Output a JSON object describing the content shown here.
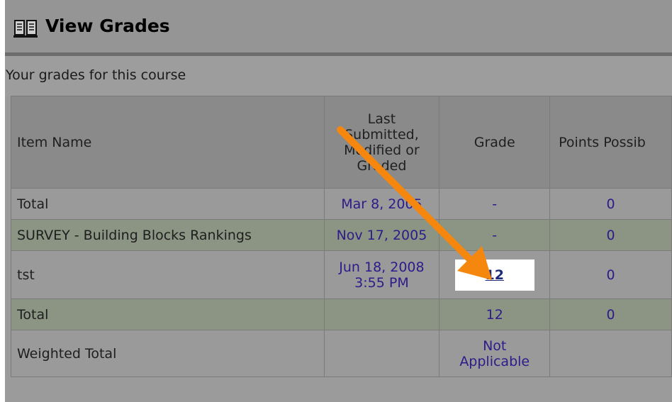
{
  "page": {
    "title": "View Grades",
    "caption": "Your grades for this course"
  },
  "icons": {
    "title_icon": "book-icon",
    "annotation": "arrow-icon",
    "arrow_color": "#f5870f"
  },
  "colors": {
    "link": "#2e1a8a",
    "row_alt": "#8c9584",
    "highlight": "#ffffff"
  },
  "table": {
    "columns": [
      "Item Name",
      "Last Submitted, Modified or Graded",
      "Grade",
      "Points Possib"
    ],
    "header_last_lines": [
      "Last",
      "Submitted,",
      "Modified or",
      "Graded"
    ],
    "rows": [
      {
        "name": "Total",
        "date": "Mar 8, 2005",
        "grade": "-",
        "points": "0"
      },
      {
        "name": "SURVEY - Building Blocks Rankings",
        "date": "Nov 17, 2005",
        "grade": "-",
        "points": "0"
      },
      {
        "name": "tst",
        "date_line1": "Jun 18, 2008",
        "date_line2": "3:55 PM",
        "grade": "12",
        "points": "0"
      },
      {
        "name": "Total",
        "date": "",
        "grade": "12",
        "points": "0"
      },
      {
        "name": "Weighted Total",
        "date": "",
        "grade_line1": "Not",
        "grade_line2": "Applicable",
        "points": ""
      }
    ]
  }
}
